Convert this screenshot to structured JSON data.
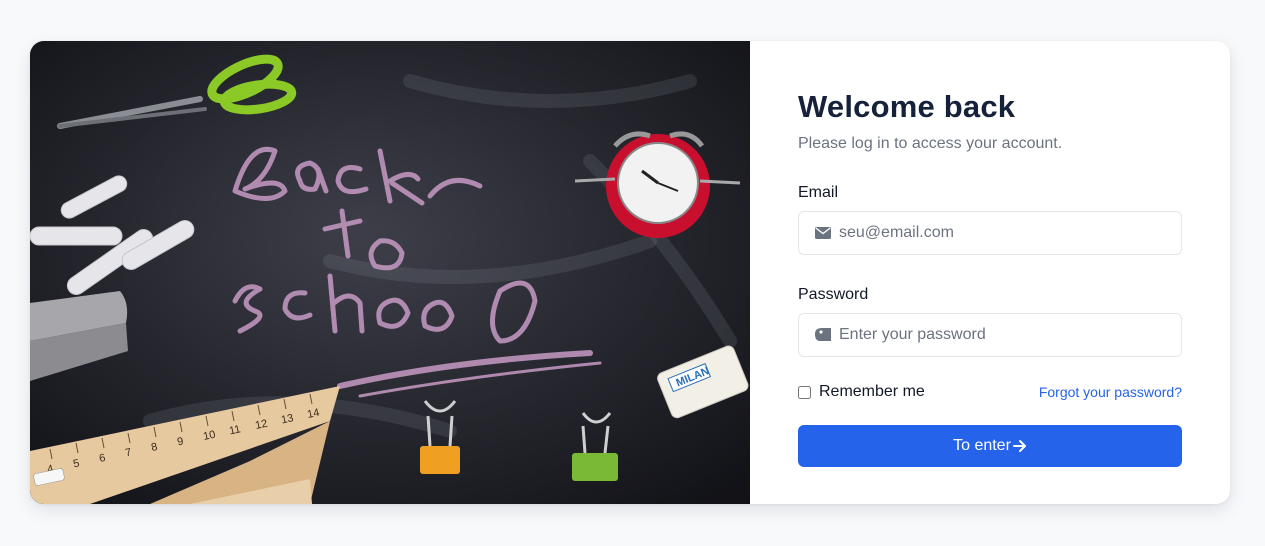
{
  "login": {
    "title": "Welcome back",
    "subtitle": "Please log in to access your account.",
    "email_label": "Email",
    "email_placeholder": "seu@email.com",
    "email_icon": "envelope-icon",
    "password_label": "Password",
    "password_placeholder": "Enter your password",
    "password_icon": "tag-icon",
    "remember_label": "Remember me",
    "remember_checked": false,
    "forgot_link": "Forgot your password?",
    "submit_label": "To enter",
    "submit_icon": "arrow-right-icon"
  },
  "illustration": {
    "chalk_text": [
      "back",
      "to",
      "school"
    ],
    "eraser_brand": "MILAN",
    "ruler_ticks": [
      "4",
      "5",
      "6",
      "7",
      "8",
      "9",
      "10",
      "11",
      "12",
      "13",
      "14"
    ]
  },
  "colors": {
    "page_bg": "#f7f9fb",
    "primary": "#2563eb",
    "title": "#16213a",
    "muted": "#6b7280",
    "input_border": "#e3e6ea"
  }
}
